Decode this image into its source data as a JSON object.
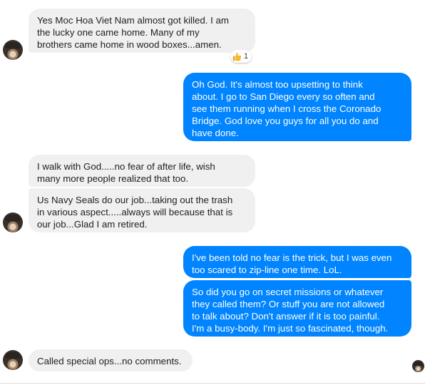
{
  "messages": [
    {
      "text": "Yes Moc Hoa Viet Nam almost got killed.  I am\nthe lucky one came home. Many of my\nbrothers came home in wood boxes...amen."
    },
    {
      "text": "Oh God. It's almost too upsetting to think\nabout.  I go to San Diego every so often and\nsee them running when I cross the Coronado\nBridge.  God love you guys for all you do and\nhave done."
    },
    {
      "text": "I walk with God.....no fear of after life, wish\nmany more people realized that too."
    },
    {
      "text": "Us Navy Seals do our job...taking out the trash\nin various aspect.....always will because that is\nour job...Glad I am retired."
    },
    {
      "text": "I've been told no fear is the trick, but I was even\ntoo scared to zip-line one time. LoL."
    },
    {
      "text": "So did you go on secret missions or whatever\nthey called them?  Or stuff you are not allowed\nto talk about?  Don't answer if it is too painful.\nI'm a busy-body.  I'm just so fascinated, though."
    },
    {
      "text": "Called special ops...no comments."
    }
  ],
  "reaction": {
    "icon": "thumbs-up-icon",
    "count": "1"
  },
  "colors": {
    "outgoing": "#0084ff",
    "incoming": "#f1f0f0",
    "reaction_thumb": "#f7b928"
  }
}
